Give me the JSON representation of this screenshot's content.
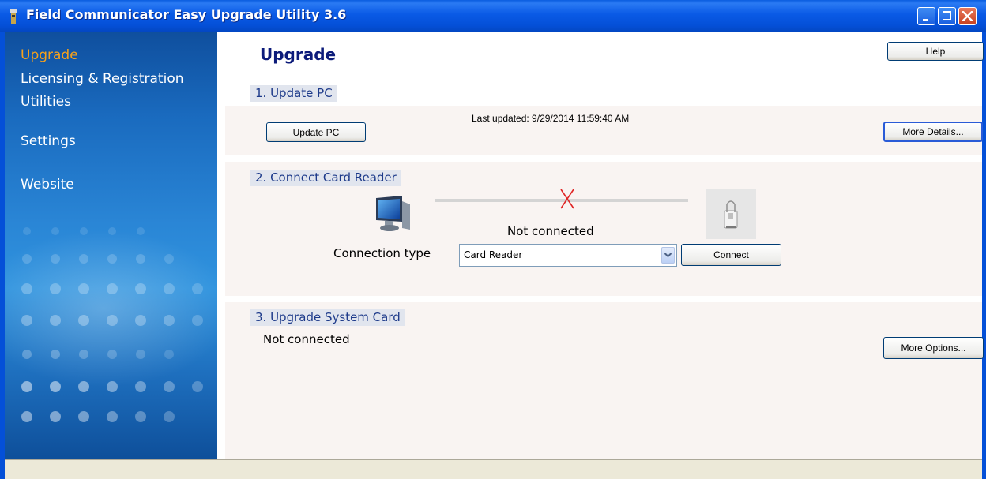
{
  "window": {
    "title": "Field Communicator Easy Upgrade Utility 3.6",
    "accent_color": "#0450d8",
    "close_color": "#d0491f"
  },
  "sidebar": {
    "items": [
      {
        "label": "Upgrade",
        "active": true
      },
      {
        "label": "Licensing & Registration",
        "active": false
      },
      {
        "label": "Utilities",
        "active": false
      },
      {
        "label": "Settings",
        "active": false
      },
      {
        "label": "Website",
        "active": false
      }
    ],
    "active_color": "#f6a21b"
  },
  "main": {
    "title": "Upgrade",
    "help_label": "Help",
    "update_pc": {
      "label": "1. Update PC",
      "button": "Update PC",
      "last_updated": "Last updated: 9/29/2014 11:59:40 AM",
      "details_button": "More Details..."
    },
    "connect_reader": {
      "label": "2. Connect Card Reader",
      "status": "Not connected",
      "connection_type_label": "Connection type",
      "connection_type_value": "Card Reader",
      "connect_button": "Connect",
      "icons": [
        "computer-icon",
        "disconnected-x-icon",
        "card-reader-icon"
      ]
    },
    "upgrade_card": {
      "label": "3. Upgrade System Card",
      "status": "Not connected",
      "options_button": "More Options..."
    }
  }
}
